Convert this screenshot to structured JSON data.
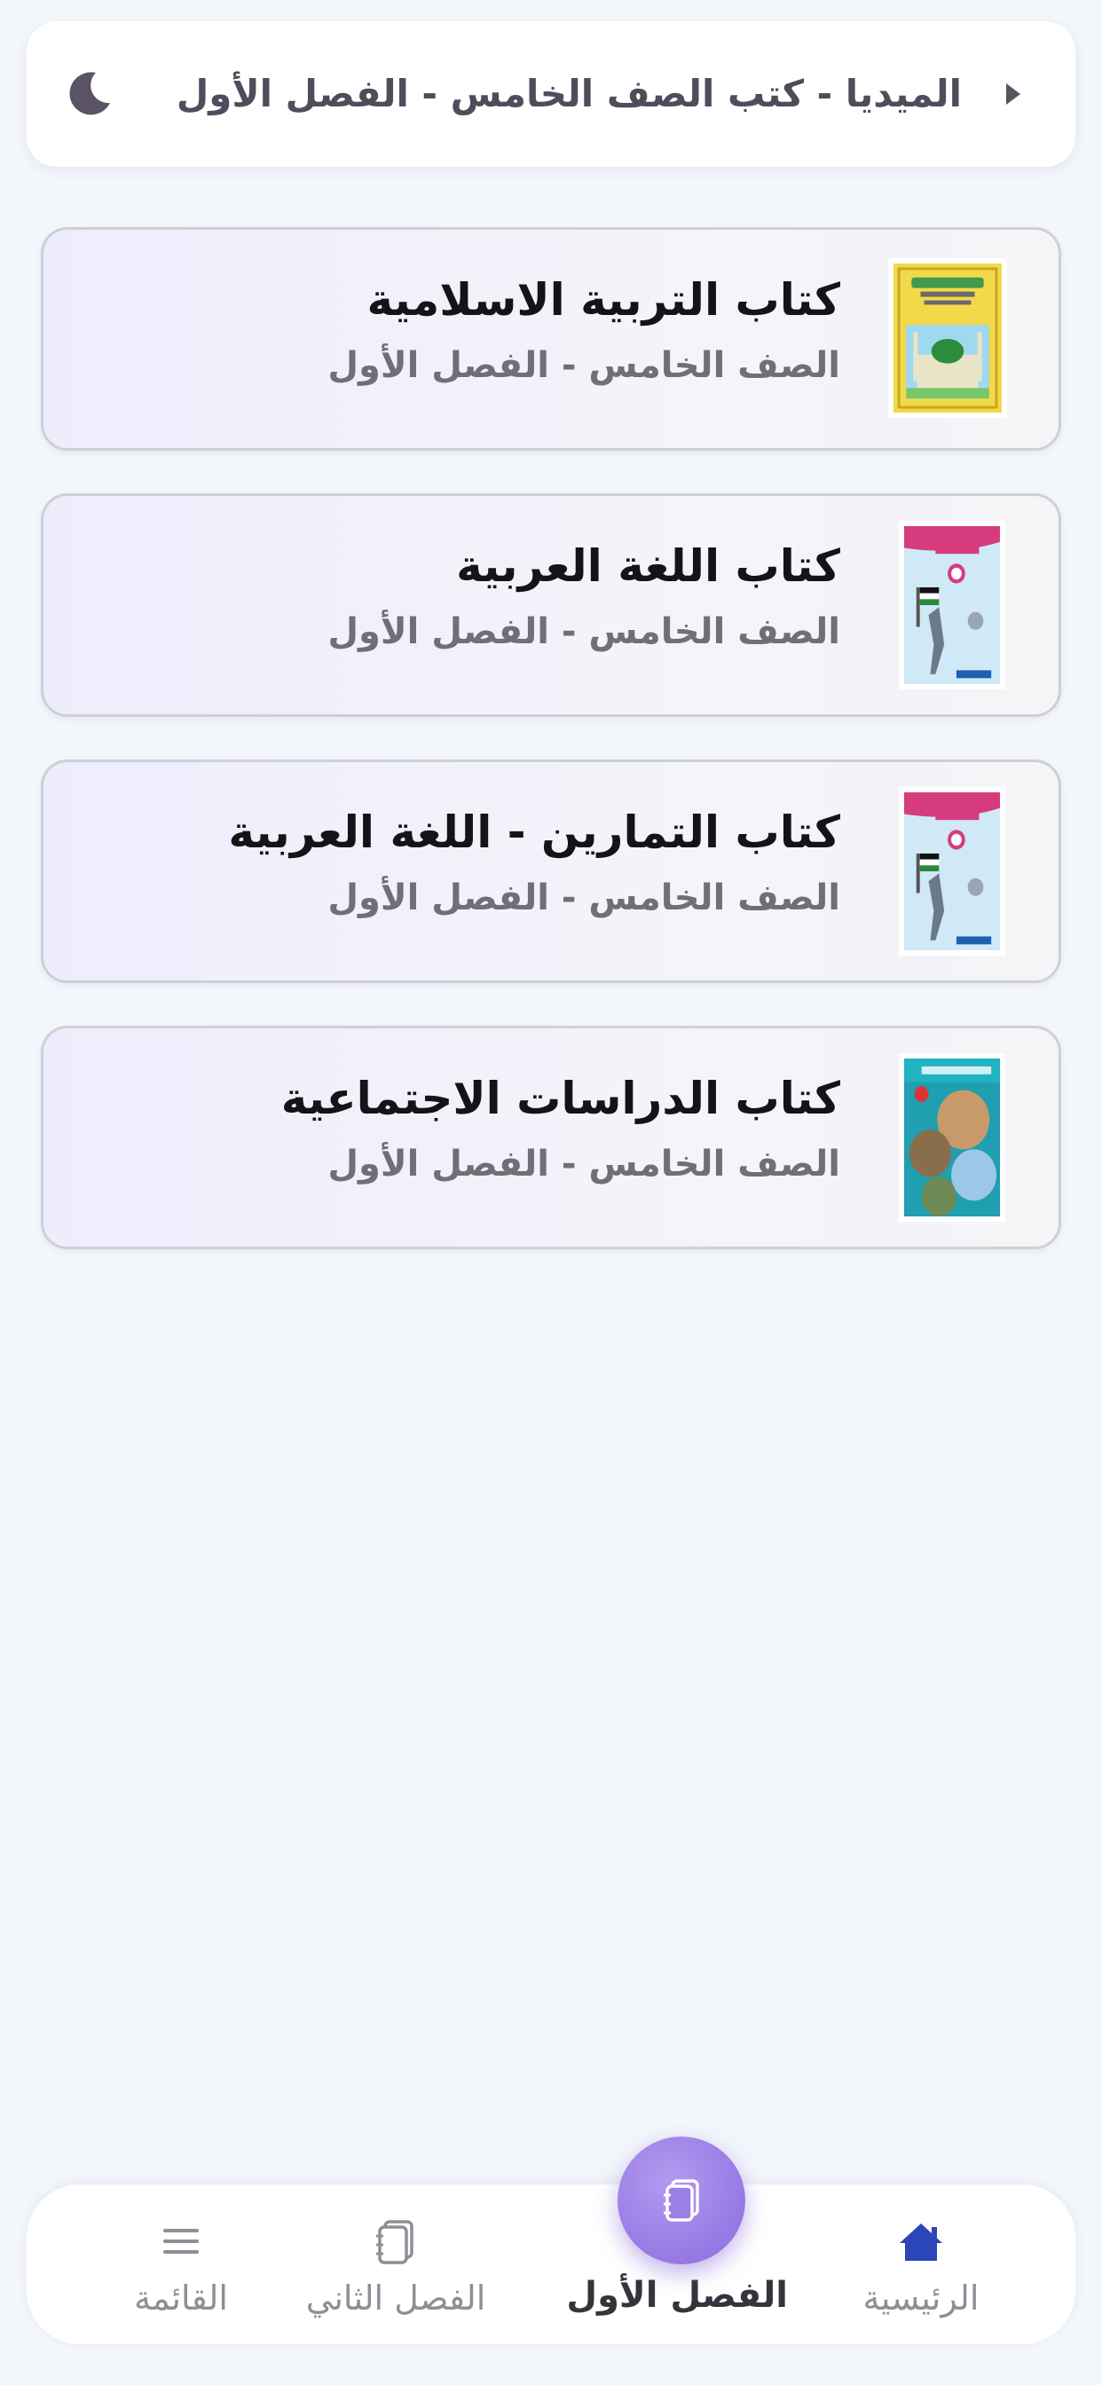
{
  "header": {
    "title": "الميديا - كتب الصف الخامس - الفصل الأول",
    "left_icon": "moon-icon",
    "right_icon": "caret-right-icon"
  },
  "books": [
    {
      "title": "كتاب التربية الاسلامية",
      "subtitle": "الصف الخامس - الفصل الأول",
      "cover": "islamic-education-cover"
    },
    {
      "title": "كتاب اللغة العربية",
      "subtitle": "الصف الخامس - الفصل الأول",
      "cover": "arabic-language-cover"
    },
    {
      "title": "كتاب التمارين - اللغة العربية",
      "subtitle": "الصف الخامس - الفصل الأول",
      "cover": "arabic-exercises-cover"
    },
    {
      "title": "كتاب الدراسات الاجتماعية",
      "subtitle": "الصف الخامس - الفصل الأول",
      "cover": "social-studies-cover"
    }
  ],
  "bottom_nav": {
    "items": [
      {
        "label": "القائمة",
        "icon": "menu-icon"
      },
      {
        "label": "الفصل الثاني",
        "icon": "notebook-icon"
      },
      {
        "label": "الفصل الأول",
        "icon": "notebook-icon",
        "active": true
      },
      {
        "label": "الرئيسية",
        "icon": "home-icon"
      }
    ]
  },
  "colors": {
    "accent": "#8b6adf",
    "background": "#f3f6fb",
    "home_icon": "#2a46b8"
  }
}
